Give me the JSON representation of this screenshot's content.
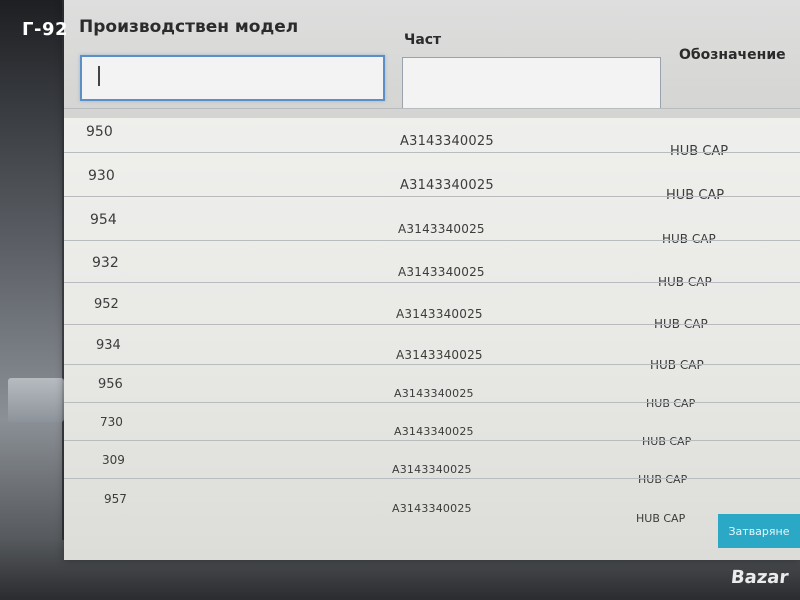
{
  "watermark": {
    "top_left": "Г-92",
    "bottom_right": "Bazar"
  },
  "filters": {
    "model_label": "Производствен модел",
    "part_label": "Част",
    "description_label": "Обозначение",
    "model_value": "",
    "part_value": ""
  },
  "rows": [
    {
      "model": "950",
      "part": "A3143340025",
      "description": "HUB CAP"
    },
    {
      "model": "930",
      "part": "A3143340025",
      "description": "HUB CAP"
    },
    {
      "model": "954",
      "part": "A3143340025",
      "description": "HUB CAP"
    },
    {
      "model": "932",
      "part": "A3143340025",
      "description": "HUB CAP"
    },
    {
      "model": "952",
      "part": "A3143340025",
      "description": "HUB CAP"
    },
    {
      "model": "934",
      "part": "A3143340025",
      "description": "HUB CAP"
    },
    {
      "model": "956",
      "part": "A3143340025",
      "description": "HUB CAP"
    },
    {
      "model": "730",
      "part": "A3143340025",
      "description": "HUB CAP"
    },
    {
      "model": "309",
      "part": "A3143340025",
      "description": "HUB CAP"
    },
    {
      "model": "957",
      "part": "A3143340025",
      "description": "HUB CAP"
    }
  ],
  "actions": {
    "close_label": "Затваряне"
  },
  "colors": {
    "accent": "#2aa8c6",
    "focus_border": "#5b8fc5"
  }
}
